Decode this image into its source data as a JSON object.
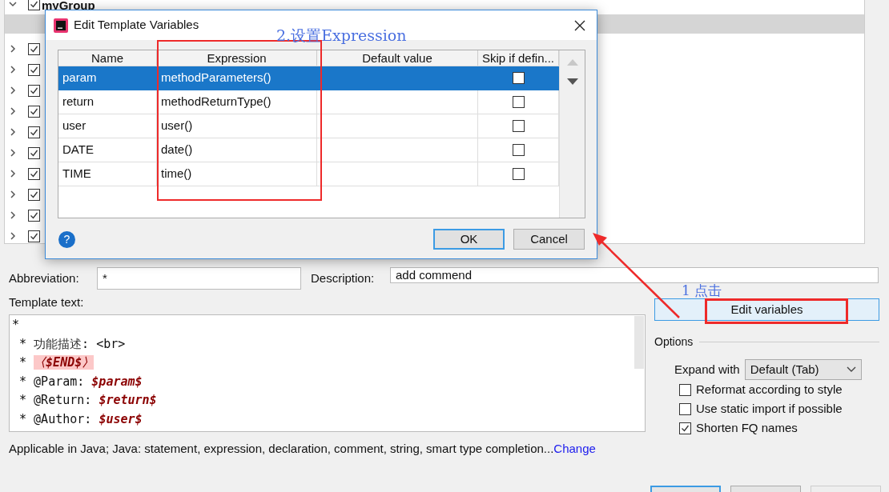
{
  "tree": {
    "items": [
      {
        "label": "myGroup",
        "checked": true,
        "expanded": true,
        "children": [
          {
            "selected": true
          }
        ]
      },
      {
        "checked": true,
        "expanded": false
      },
      {
        "checked": true,
        "expanded": false
      },
      {
        "checked": true,
        "expanded": false
      },
      {
        "checked": true,
        "expanded": false
      },
      {
        "checked": true,
        "expanded": false
      },
      {
        "checked": true,
        "expanded": false
      },
      {
        "checked": true,
        "expanded": false
      },
      {
        "checked": true,
        "expanded": false
      },
      {
        "checked": true,
        "expanded": false
      },
      {
        "checked": true,
        "expanded": false
      }
    ]
  },
  "dialog": {
    "title": "Edit Template Variables",
    "columns": [
      "Name",
      "Expression",
      "Default value",
      "Skip if defin..."
    ],
    "rows": [
      {
        "name": "param",
        "expression": "methodParameters()",
        "skip_if_defined": false,
        "selected": true
      },
      {
        "name": "return",
        "expression": "methodReturnType()",
        "skip_if_defined": false,
        "selected": false
      },
      {
        "name": "user",
        "expression": "user()",
        "skip_if_defined": false,
        "selected": false
      },
      {
        "name": "DATE",
        "expression": "date()",
        "skip_if_defined": false,
        "selected": false
      },
      {
        "name": "TIME",
        "expression": "time()",
        "skip_if_defined": false,
        "selected": false
      }
    ],
    "help": "?",
    "buttons": [
      {
        "label": "OK",
        "default": true
      },
      {
        "label": "Cancel",
        "default": false
      }
    ]
  },
  "form": {
    "abbreviation_label": "Abbreviation:",
    "abbreviation": "*",
    "description_label": "Description:",
    "description": "add commend",
    "template_label": "Template text:",
    "template_lines": [
      [
        {
          "text": "*"
        }
      ],
      [
        {
          "text": " * "
        },
        {
          "text": "功能描述",
          "kind": "cjk"
        },
        {
          "text": ": <br>"
        }
      ],
      [
        {
          "text": " * "
        },
        {
          "text": "〈$END$〉",
          "kind": "end"
        }
      ],
      [
        {
          "text": " * @Param: "
        },
        {
          "text": "$param$",
          "kind": "variable"
        }
      ],
      [
        {
          "text": " * @Return: "
        },
        {
          "text": "$return$",
          "kind": "variable"
        }
      ],
      [
        {
          "text": " * @Author: "
        },
        {
          "text": "$user$",
          "kind": "variable"
        }
      ]
    ],
    "edit_variables": "Edit variables",
    "options_title": "Options",
    "expand_label": "Expand with",
    "expand_value": "Default (Tab)",
    "options": [
      {
        "label": "Reformat according to style",
        "checked": false
      },
      {
        "label": "Use static import if possible",
        "checked": false
      },
      {
        "label": "Shorten FQ names",
        "checked": true
      }
    ],
    "applicable": "Applicable in Java; Java: statement, expression, declaration, comment, string, smart type completion...",
    "change_link": "Change"
  },
  "annotations": [
    {
      "text": "2.设置Expression"
    },
    {
      "text": "1 点击"
    }
  ]
}
